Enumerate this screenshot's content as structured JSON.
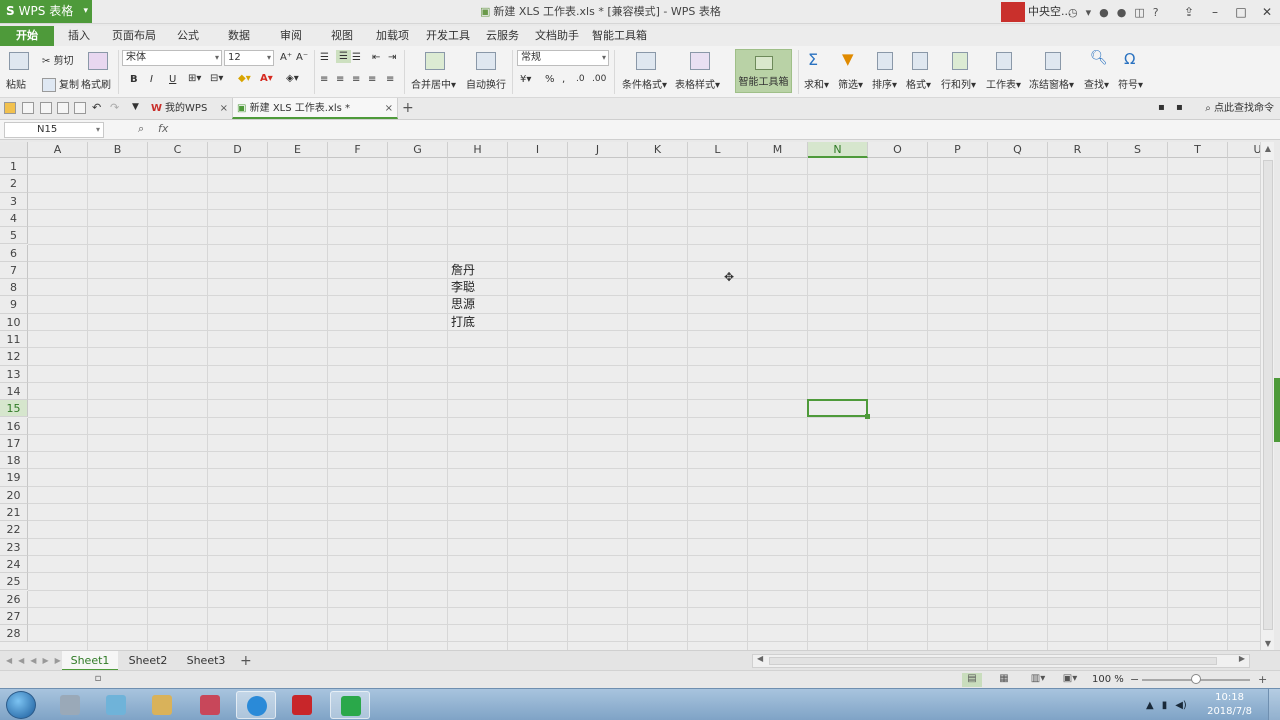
{
  "app": {
    "name": "WPS 表格",
    "logo_letter": "S"
  },
  "window": {
    "title": "新建 XLS 工作表.xls * [兼容模式] - WPS 表格",
    "user": "中央空..."
  },
  "menu": {
    "tabs": [
      "开始",
      "插入",
      "页面布局",
      "公式",
      "数据",
      "审阅",
      "视图",
      "加载项",
      "开发工具",
      "云服务",
      "文档助手",
      "智能工具箱"
    ]
  },
  "ribbon": {
    "paste": "粘贴",
    "cut": "剪切",
    "copy": "复制",
    "format_painter": "格式刷",
    "font_name": "宋体",
    "font_size": "12",
    "merge_center": "合并居中",
    "wrap_text": "自动换行",
    "number_format": "常规",
    "conditional_format": "条件格式",
    "table_style": "表格样式",
    "smart_toolbox": "智能工具箱",
    "sum": "求和",
    "filter": "筛选",
    "sort": "排序",
    "format": "格式",
    "row_col": "行和列",
    "worksheet": "工作表",
    "freeze": "冻结窗格",
    "find": "查找",
    "symbol": "符号",
    "bold": "B",
    "italic": "I",
    "underline": "U",
    "percent": "%"
  },
  "tabs": {
    "my_wps": "我的WPS",
    "current_doc": "新建 XLS 工作表.xls *",
    "find_command": "点此查找命令"
  },
  "formula_bar": {
    "name_box": "N15",
    "fx": "fx",
    "value": ""
  },
  "sheet": {
    "columns": [
      "A",
      "B",
      "C",
      "D",
      "E",
      "F",
      "G",
      "H",
      "I",
      "J",
      "K",
      "L",
      "M",
      "N",
      "O",
      "P",
      "Q",
      "R",
      "S",
      "T",
      "U"
    ],
    "rows": [
      "1",
      "2",
      "3",
      "4",
      "5",
      "6",
      "7",
      "8",
      "9",
      "10",
      "11",
      "12",
      "13",
      "14",
      "15",
      "16",
      "17",
      "18",
      "19",
      "20",
      "21",
      "22",
      "23",
      "24",
      "25",
      "26",
      "27",
      "28"
    ],
    "selected_cell": "N15",
    "cells": [
      {
        "ref": "H7",
        "value": "詹丹"
      },
      {
        "ref": "H8",
        "value": "李聪"
      },
      {
        "ref": "H9",
        "value": "思源"
      },
      {
        "ref": "H10",
        "value": "打底"
      }
    ]
  },
  "sheet_tabs": [
    "Sheet1",
    "Sheet2",
    "Sheet3"
  ],
  "active_sheet": "Sheet1",
  "status": {
    "zoom": "100 %",
    "zoom_level": 0.5
  },
  "taskbar": {
    "time": "10:18",
    "date": "2018/7/8"
  },
  "colors": {
    "accent": "#4e9a3a",
    "selection": "#d6e6cd"
  }
}
